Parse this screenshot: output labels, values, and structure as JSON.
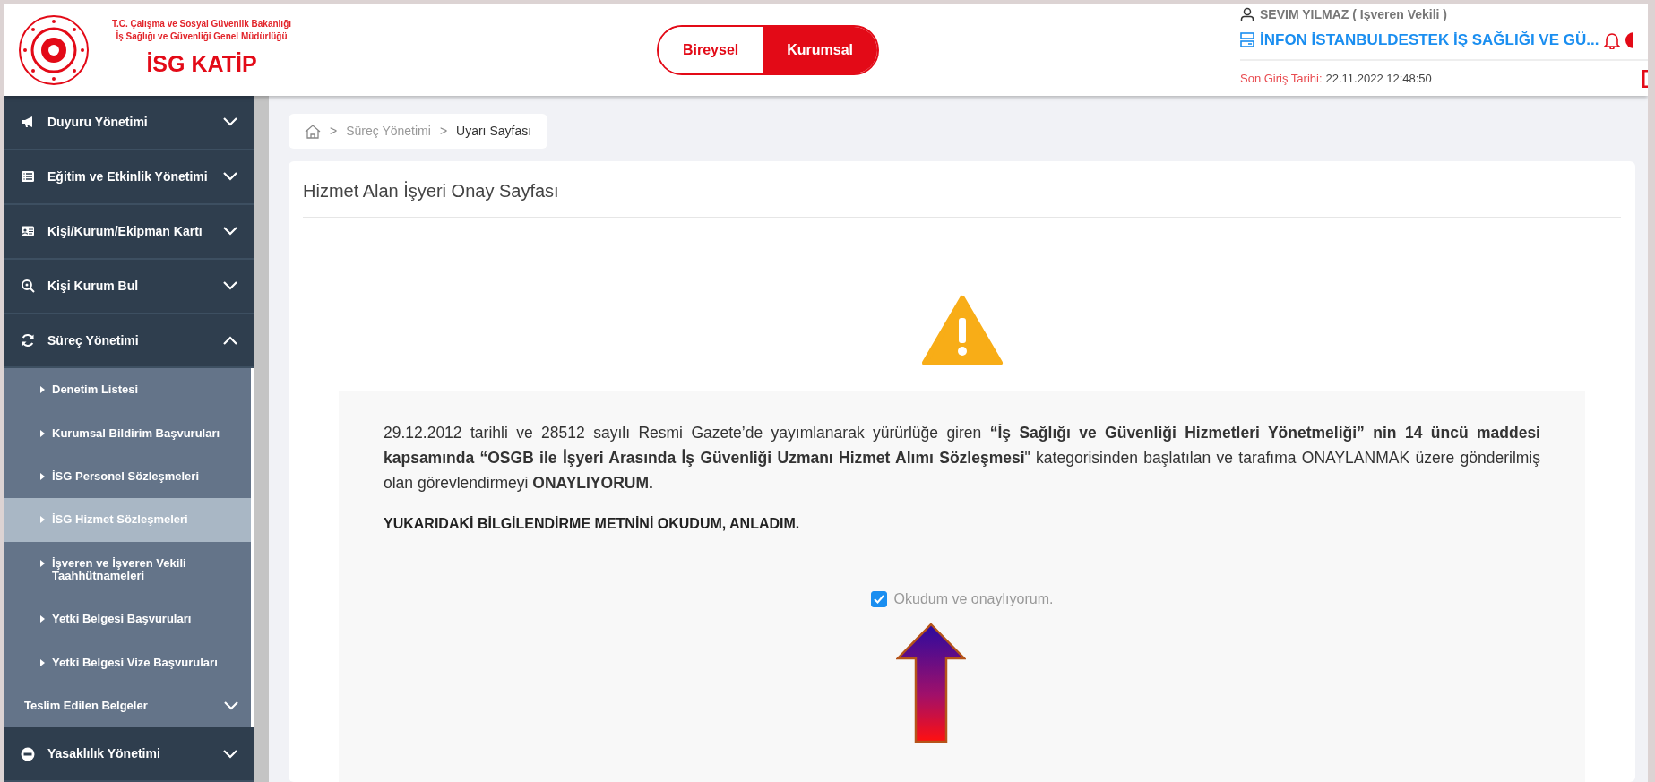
{
  "header": {
    "ministry": "T.C. Çalışma ve Sosyal Güvenlik Bakanlığı İş Sağlığı ve Güvenliği Genel Müdürlüğü",
    "app_name": "İSG KATİP",
    "mode_tabs": [
      {
        "label": "Bireysel",
        "selected": false
      },
      {
        "label": "Kurumsal",
        "selected": true
      }
    ],
    "user": "SEVIM YILMAZ ( Işveren Vekili )",
    "company": "İNFON İSTANBULDESTEK İŞ SAĞLIĞI VE GÜ...",
    "last_login_label": "Son Giriş Tarihi:",
    "last_login": "22.11.2022 12:48:50"
  },
  "sidebar": {
    "items": [
      {
        "label": "Duyuru Yönetimi",
        "expanded": false
      },
      {
        "label": "Eğitim ve Etkinlik Yönetimi",
        "expanded": false
      },
      {
        "label": "Kişi/Kurum/Ekipman Kartı",
        "expanded": false
      },
      {
        "label": "Kişi Kurum Bul",
        "expanded": false
      },
      {
        "label": "Süreç Yönetimi",
        "expanded": true,
        "children": [
          {
            "kind": "link",
            "label": "Denetim Listesi",
            "selected": false
          },
          {
            "kind": "link",
            "label": "Kurumsal Bildirim Başvuruları",
            "selected": false
          },
          {
            "kind": "link",
            "label": "İSG Personel Sözleşmeleri",
            "selected": false
          },
          {
            "kind": "link",
            "label": "İSG Hizmet Sözleşmeleri",
            "selected": true
          },
          {
            "kind": "link",
            "label": "İşveren ve İşveren Vekili Taahhütnameleri",
            "selected": false
          },
          {
            "kind": "link",
            "label": "Yetki Belgesi Başvuruları",
            "selected": false
          },
          {
            "kind": "link",
            "label": "Yetki Belgesi Vize Başvuruları",
            "selected": false
          },
          {
            "kind": "group",
            "label": "Teslim Edilen Belgeler",
            "selected": false
          }
        ]
      },
      {
        "label": "Yasaklılık Yönetimi",
        "expanded": false
      }
    ]
  },
  "breadcrumb": [
    {
      "separator": ">",
      "label": "Süreç Yönetimi"
    },
    {
      "separator": ">",
      "label": "Uyarı Sayfası"
    }
  ],
  "page_title": "Hizmet Alan İşyeri Onay Sayfası",
  "notice": {
    "paragraph": "29.12.2012 tarihli ve 28512 sayılı Resmi Gazete’de yayımlanarak yürürlüğe giren **“İş Sağlığı ve Güvenliği Hizmetleri Yönetmeliği” nin 14 üncü maddesi kapsamında “OSGB ile İşyeri Arasında İş Güvenliği Uzmanı Hizmet Alımı Sözleşmesi**\" kategorisinden başlatılan ve tarafıma ONAYLANMAK üzere gönderilmiş olan görevlendirmeyi **ONAYLIYORUM.**",
    "statement": "YUKARIDAKİ BİLGİLENDİRME METNİNİ OKUDUM, ANLADIM.",
    "consent": {
      "label": "Okudum ve onaylıyorum.",
      "checked": true
    }
  }
}
